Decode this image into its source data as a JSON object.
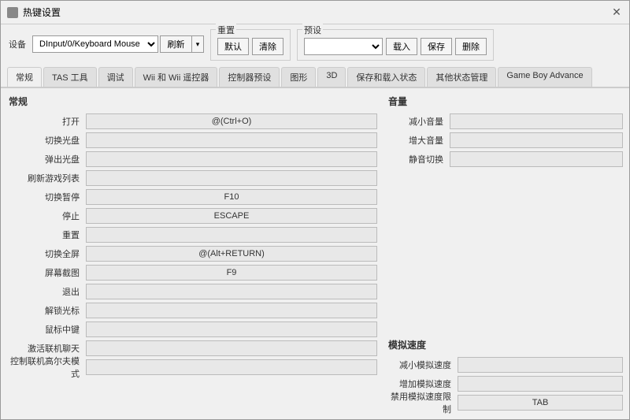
{
  "window": {
    "title": "热键设置",
    "close_label": "✕"
  },
  "toolbar": {
    "device_label": "设备",
    "device_value": "DInput/0/Keyboard Mouse",
    "refresh_label": "刷新",
    "reset_section": "重置",
    "default_label": "默认",
    "clear_label": "清除",
    "preset_section": "预设",
    "preset_placeholder": "",
    "load_label": "载入",
    "save_label": "保存",
    "delete_label": "删除"
  },
  "tabs": [
    {
      "id": "general",
      "label": "常规",
      "active": true
    },
    {
      "id": "tas",
      "label": "TAS 工具",
      "active": false
    },
    {
      "id": "debug",
      "label": "调试",
      "active": false
    },
    {
      "id": "wii",
      "label": "Wii 和 Wii 遥控器",
      "active": false
    },
    {
      "id": "controller_preset",
      "label": "控制器预设",
      "active": false
    },
    {
      "id": "graphics",
      "label": "图形",
      "active": false
    },
    {
      "id": "3d",
      "label": "3D",
      "active": false
    },
    {
      "id": "save_load",
      "label": "保存和载入状态",
      "active": false
    },
    {
      "id": "other_state",
      "label": "其他状态管理",
      "active": false
    },
    {
      "id": "gba",
      "label": "Game Boy Advance",
      "active": false
    }
  ],
  "left": {
    "section_title": "常规",
    "rows": [
      {
        "label": "打开",
        "value": "@(Ctrl+O)"
      },
      {
        "label": "切换光盘",
        "value": ""
      },
      {
        "label": "弹出光盘",
        "value": ""
      },
      {
        "label": "刷新游戏列表",
        "value": ""
      },
      {
        "label": "切换暂停",
        "value": "F10"
      },
      {
        "label": "停止",
        "value": "ESCAPE"
      },
      {
        "label": "重置",
        "value": ""
      },
      {
        "label": "切换全屏",
        "value": "@(Alt+RETURN)"
      },
      {
        "label": "屏幕截图",
        "value": "F9"
      },
      {
        "label": "退出",
        "value": ""
      },
      {
        "label": "解锁光标",
        "value": ""
      },
      {
        "label": "鼠标中键",
        "value": ""
      },
      {
        "label": "激活联机聊天",
        "value": ""
      },
      {
        "label": "控制联机高尔夫模式",
        "value": ""
      }
    ]
  },
  "right": {
    "volume_title": "音量",
    "volume_rows": [
      {
        "label": "减小音量",
        "value": ""
      },
      {
        "label": "增大音量",
        "value": ""
      },
      {
        "label": "静音切换",
        "value": ""
      }
    ],
    "emulation_title": "模拟速度",
    "emulation_rows": [
      {
        "label": "减小模拟速度",
        "value": ""
      },
      {
        "label": "增加模拟速度",
        "value": ""
      },
      {
        "label": "禁用模拟速度限制",
        "value": "TAB"
      }
    ]
  }
}
